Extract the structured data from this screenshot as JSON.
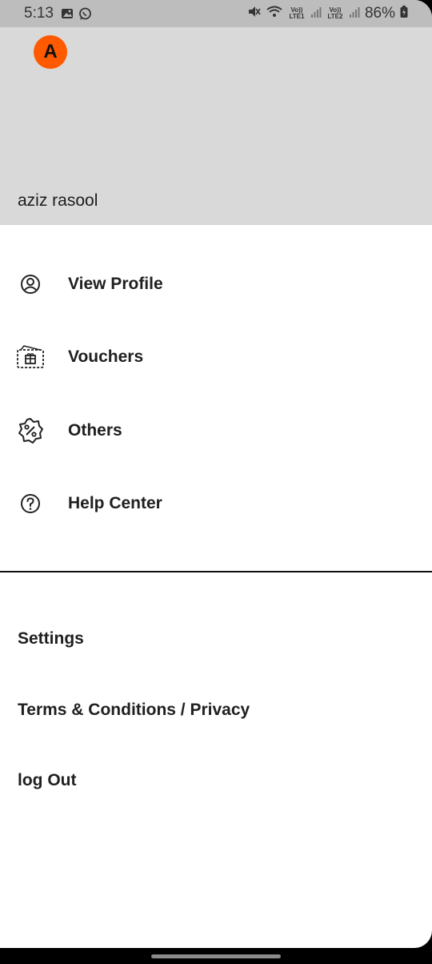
{
  "status_bar": {
    "time": "5:13",
    "battery": "86%",
    "lte1": "Vo)) LTE1",
    "lte2": "Vo)) LTE2",
    "icons": [
      "gallery-icon",
      "whatsapp-icon",
      "mute-icon",
      "wifi-icon",
      "signal-icon",
      "battery-icon"
    ]
  },
  "header": {
    "avatar_letter": "A",
    "avatar_color": "#ff5a00",
    "user_name": "aziz rasool"
  },
  "menu": {
    "items": [
      {
        "label": "View Profile",
        "icon": "user-circle-icon"
      },
      {
        "label": "Vouchers",
        "icon": "voucher-icon"
      },
      {
        "label": "Others",
        "icon": "percent-badge-icon"
      },
      {
        "label": "Help Center",
        "icon": "help-circle-icon"
      }
    ]
  },
  "footer_links": {
    "settings": "Settings",
    "terms": "Terms & Conditions / Privacy",
    "logout": "log Out"
  }
}
